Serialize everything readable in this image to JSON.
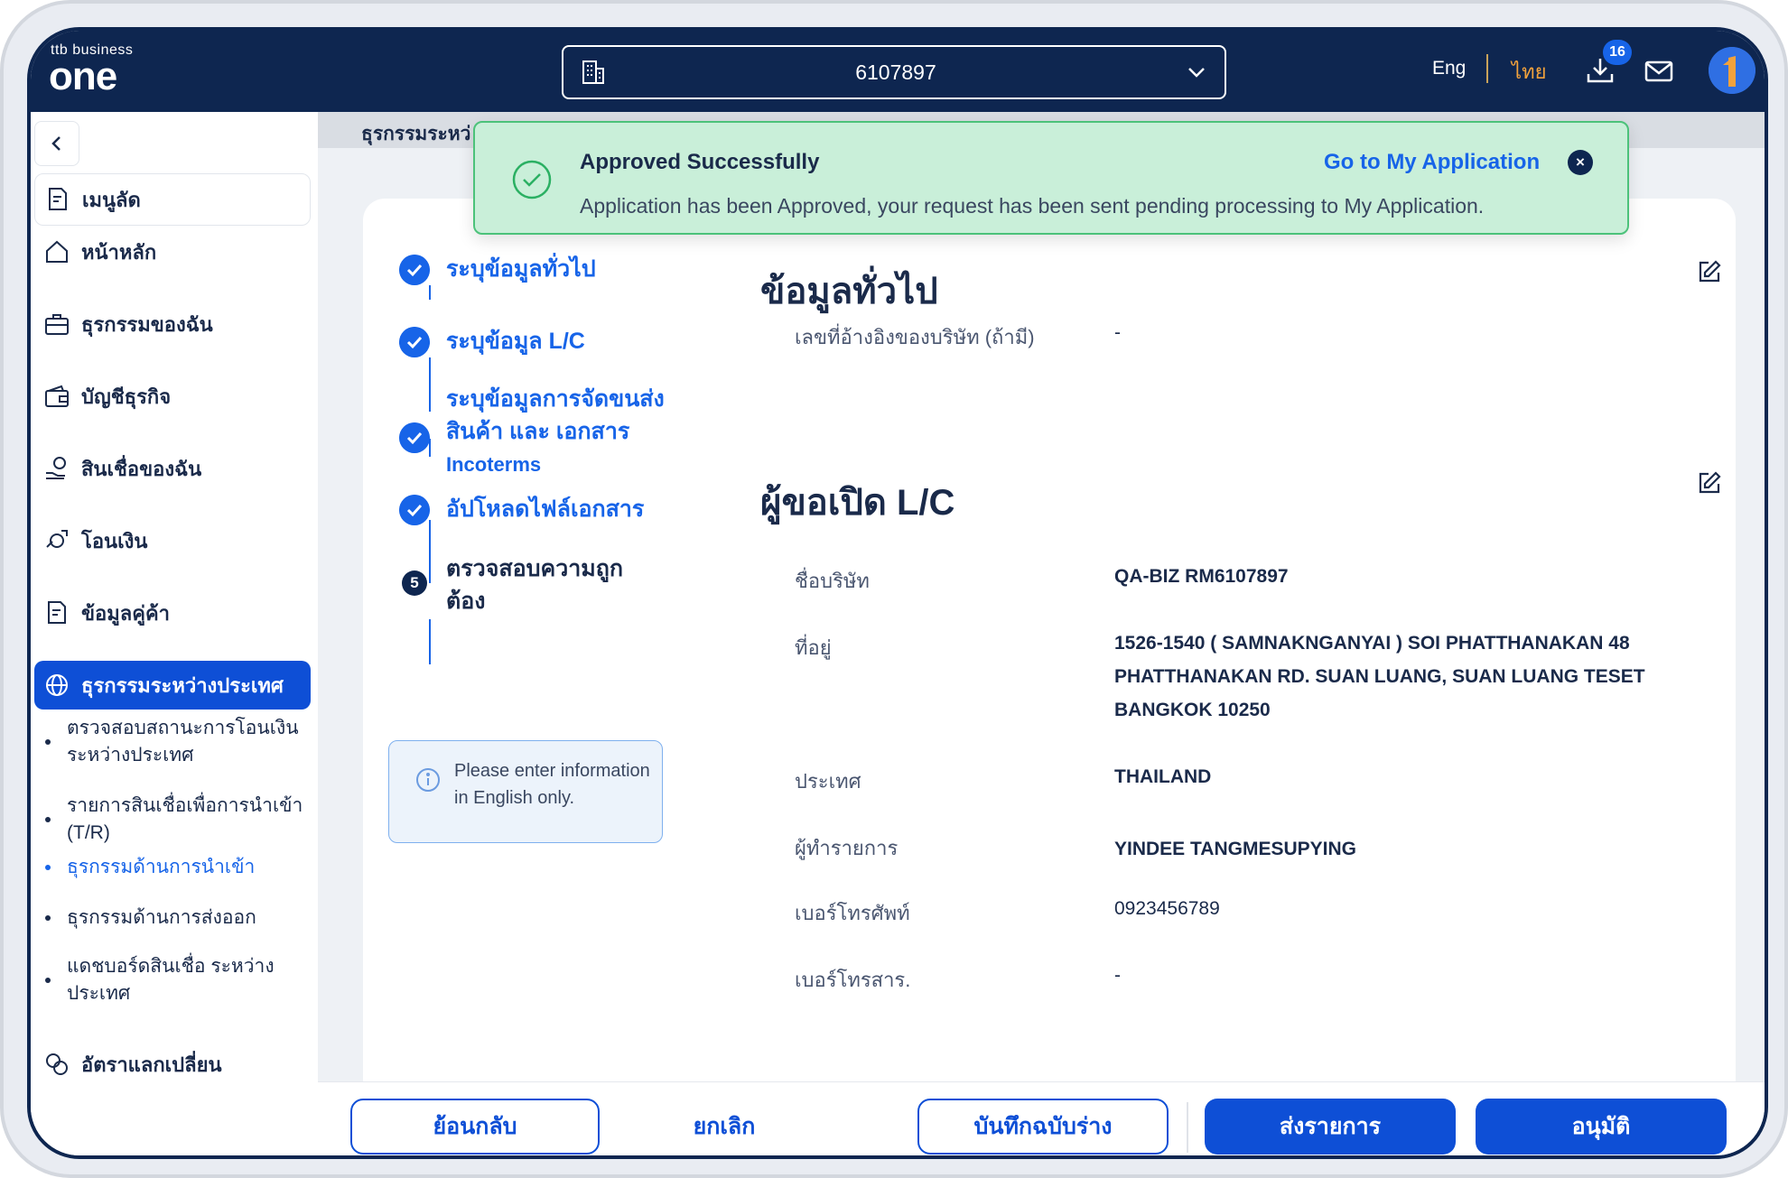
{
  "header": {
    "logo_small": "ttb business",
    "logo_big": "one",
    "account_number": "6107897",
    "lang_en": "Eng",
    "lang_th": "ไทย",
    "download_count": "16"
  },
  "sidebar": {
    "shortcut_label": "เมนูลัด",
    "items": [
      {
        "label": "หน้าหลัก"
      },
      {
        "label": "ธุรกรรมของฉัน"
      },
      {
        "label": "บัญชีธุรกิจ"
      },
      {
        "label": "สินเชื่อของฉัน"
      },
      {
        "label": "โอนเงิน"
      },
      {
        "label": "ข้อมูลคู่ค้า"
      },
      {
        "label": "ธุรกรรมระหว่างประเทศ"
      }
    ],
    "sub_items": [
      {
        "label": "ตรวจสอบสถานะการโอนเงินระหว่างประเทศ"
      },
      {
        "label": "รายการสินเชื่อเพื่อการนำเข้า (T/R)"
      },
      {
        "label": "ธุรกรรมด้านการนำเข้า"
      },
      {
        "label": "ธุรกรรมด้านการส่งออก"
      },
      {
        "label": "แดชบอร์ดสินเชื่อ ระหว่างประเทศ"
      }
    ],
    "fx_label": "อัตราแลกเปลี่ยน"
  },
  "breadcrumb": "ธุรกรรมระหว่",
  "toast": {
    "title": "Approved Successfully",
    "message": "Application has been Approved, your request has been sent pending processing to My Application.",
    "link": "Go to My Application",
    "close": "×"
  },
  "steps": [
    {
      "label": "ระบุข้อมูลทั่วไป"
    },
    {
      "label": "ระบุข้อมูล L/C"
    },
    {
      "label": "ระบุข้อมูลการจัดขนส่งสินค้า และ เอกสาร",
      "sub": "Incoterms"
    },
    {
      "label": "อัปโหลดไฟล์เอกสาร"
    },
    {
      "label": "ตรวจสอบความถูกต้อง",
      "number": "5"
    }
  ],
  "info_note": "Please enter information in English only.",
  "general": {
    "title": "ข้อมูลทั่วไป",
    "ref_label": "เลขที่อ้างอิงของบริษัท (ถ้ามี)",
    "ref_value": "-"
  },
  "applicant": {
    "title": "ผู้ขอเปิด L/C",
    "company_label": "ชื่อบริษัท",
    "company_value": "QA-BIZ RM6107897",
    "address_label": "ที่อยู่",
    "address_value": "1526-1540 ( SAMNAKNGANYAI ) SOI PHATTHANAKAN 48 PHATTHANAKAN RD. SUAN LUANG, SUAN LUANG TESET BANGKOK 10250",
    "country_label": "ประเทศ",
    "country_value": "THAILAND",
    "maker_label": "ผู้ทำรายการ",
    "maker_value": "YINDEE TANGMESUPYING",
    "phone_label": "เบอร์โทรศัพท์",
    "phone_value": "0923456789",
    "fax_label": "เบอร์โทรสาร.",
    "fax_value": "-"
  },
  "actions": {
    "back": "ย้อนกลับ",
    "cancel": "ยกเลิก",
    "save_draft": "บันทึกฉบับร่าง",
    "submit": "ส่งรายการ",
    "approve": "อนุมัติ"
  },
  "colors": {
    "navy": "#0e2650",
    "primary": "#0e4fd6",
    "success_bg": "#c9efd9",
    "accent_orange": "#f2a23c"
  }
}
